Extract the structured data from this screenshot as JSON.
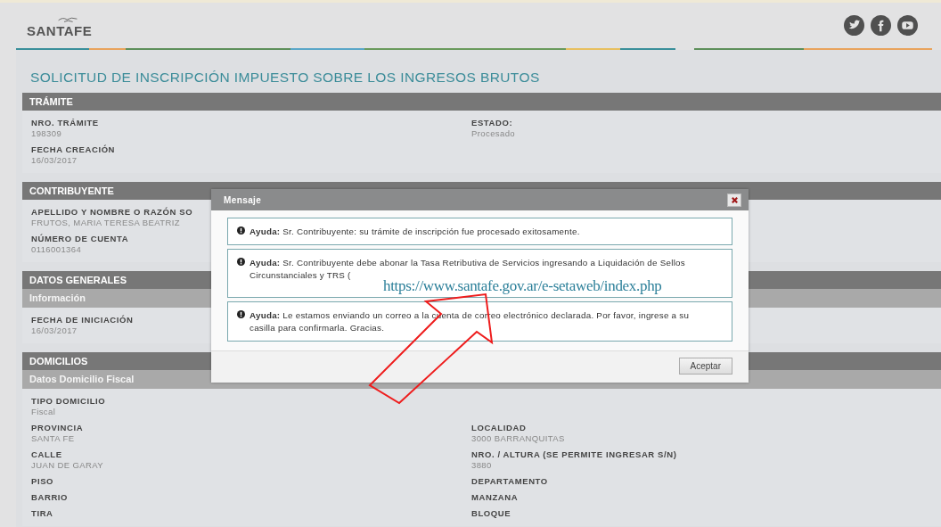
{
  "header": {
    "logo": "SANTAFE"
  },
  "page_title": "SOLICITUD DE INSCRIPCIÓN IMPUESTO SOBRE LOS INGRESOS BRUTOS",
  "sections": [
    {
      "title": "TRÁMITE",
      "rows": [
        [
          {
            "label": "NRO. TRÁMITE",
            "value": "198309"
          },
          {
            "label": "ESTADO:",
            "value": "Procesado"
          }
        ],
        [
          {
            "label": "FECHA CREACIÓN",
            "value": "16/03/2017"
          }
        ]
      ]
    },
    {
      "title": "CONTRIBUYENTE",
      "rows": [
        [
          {
            "label": "APELLIDO Y NOMBRE O RAZÓN SO",
            "value": "FRUTOS, MARIA TERESA BEATRIZ"
          }
        ],
        [
          {
            "label": "NÚMERO DE CUENTA",
            "value": "0116001364"
          }
        ]
      ]
    },
    {
      "title": "DATOS GENERALES",
      "subtitle": "Información",
      "rows": [
        [
          {
            "label": "FECHA DE INICIACIÓN",
            "value": "16/03/2017"
          }
        ]
      ]
    },
    {
      "title": "DOMICILIOS",
      "subtitle": "Datos Domicilio Fiscal",
      "rows": [
        [
          {
            "label": "TIPO DOMICILIO",
            "value": "Fiscal"
          }
        ],
        [
          {
            "label": "PROVINCIA",
            "value": "SANTA FE"
          },
          {
            "label": "LOCALIDAD",
            "value": "3000 BARRANQUITAS"
          }
        ],
        [
          {
            "label": "CALLE",
            "value": "JUAN DE GARAY"
          },
          {
            "label": "NRO. / ALTURA (SE PERMITE INGRESAR S/N)",
            "value": "3880"
          }
        ],
        [
          {
            "label": "PISO"
          },
          {
            "label": "DEPARTAMENTO"
          }
        ],
        [
          {
            "label": "BARRIO"
          },
          {
            "label": "MANZANA"
          }
        ],
        [
          {
            "label": "TIRA"
          },
          {
            "label": "BLOQUE"
          }
        ]
      ]
    }
  ],
  "dialog": {
    "title": "Mensaje",
    "messages": [
      "**Ayuda:** Sr. Contribuyente: su trámite de inscripción fue procesado exitosamente.",
      {
        "text": "**Ayuda:** Sr. Contribuyente debe abonar la Tasa Retributiva de Servicios ingresando a Liquidación de Sellos Circunstanciales y TRS (",
        "annotation_url": "https://www.santafe.gov.ar/e-setaweb/index.php"
      },
      "**Ayuda:** Le estamos enviando un correo a la cuenta de correo electrónico declarada. Por favor, ingrese a su casilla para confirmarla. Gracias."
    ],
    "button": "Aceptar"
  }
}
